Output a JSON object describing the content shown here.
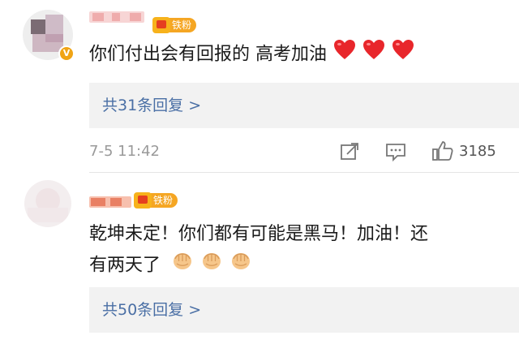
{
  "comments": [
    {
      "text": "你们付出会有回报的 高考加油",
      "emoji": [
        "red-heart",
        "red-heart",
        "red-heart"
      ],
      "fan_badge": "铁粉",
      "verified_badge": "V",
      "replies_label": "共31条回复 >",
      "time": "7-5 11:42",
      "likes": "3185"
    },
    {
      "text_line1": "乾坤未定！你们都有可能是黑马！加油！还",
      "text_line2": "有两天了",
      "emoji": [
        "fist",
        "fist",
        "fist"
      ],
      "fan_badge": "铁粉",
      "replies_label": "共50条回复 >"
    }
  ],
  "colors": {
    "link": "#4a6fa5",
    "reply_bg": "#f2f2f2",
    "meta": "#9a9a9a",
    "badge": "#f5a623"
  }
}
